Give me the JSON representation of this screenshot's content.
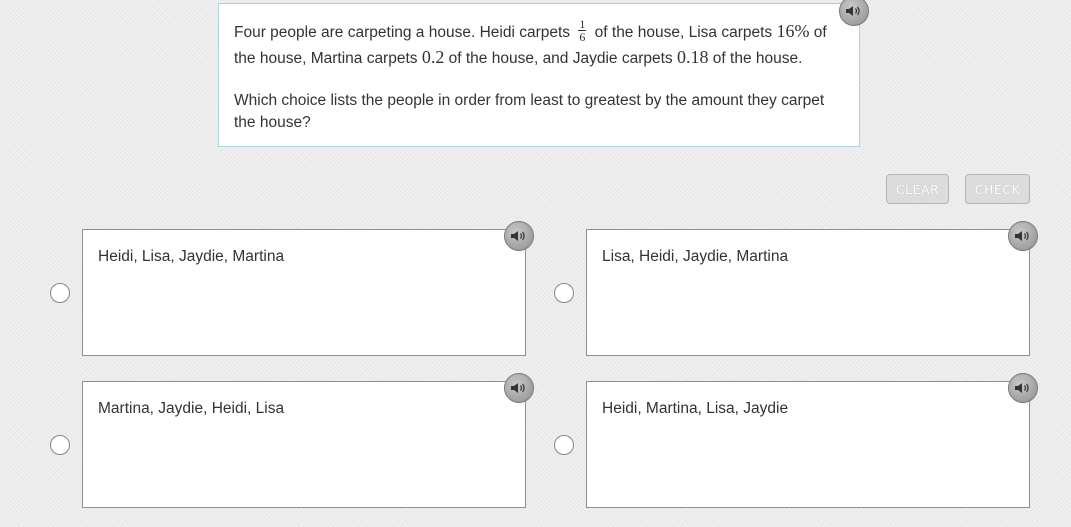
{
  "question": {
    "part1": "Four people are carpeting a house. Heidi carpets ",
    "heidi_fraction": {
      "numerator": "1",
      "denominator": "6"
    },
    "part2": " of the house, Lisa carpets ",
    "lisa_value": "16%",
    "part3": " of the house, Martina carpets ",
    "martina_value": "0.2",
    "part4": " of the house, and Jaydie carpets ",
    "jaydie_value": "0.18",
    "part5": " of the house.",
    "prompt": "Which choice lists the people in order from least to greatest by the amount they carpet the house?"
  },
  "buttons": {
    "clear": "CLEAR",
    "check": "CHECK"
  },
  "choices": [
    {
      "text": "Heidi, Lisa, Jaydie, Martina"
    },
    {
      "text": "Lisa, Heidi, Jaydie, Martina"
    },
    {
      "text": "Martina, Jaydie, Heidi, Lisa"
    },
    {
      "text": "Heidi, Martina, Lisa, Jaydie"
    }
  ],
  "icons": {
    "audio": "speaker-icon",
    "radio": "radio-button"
  }
}
